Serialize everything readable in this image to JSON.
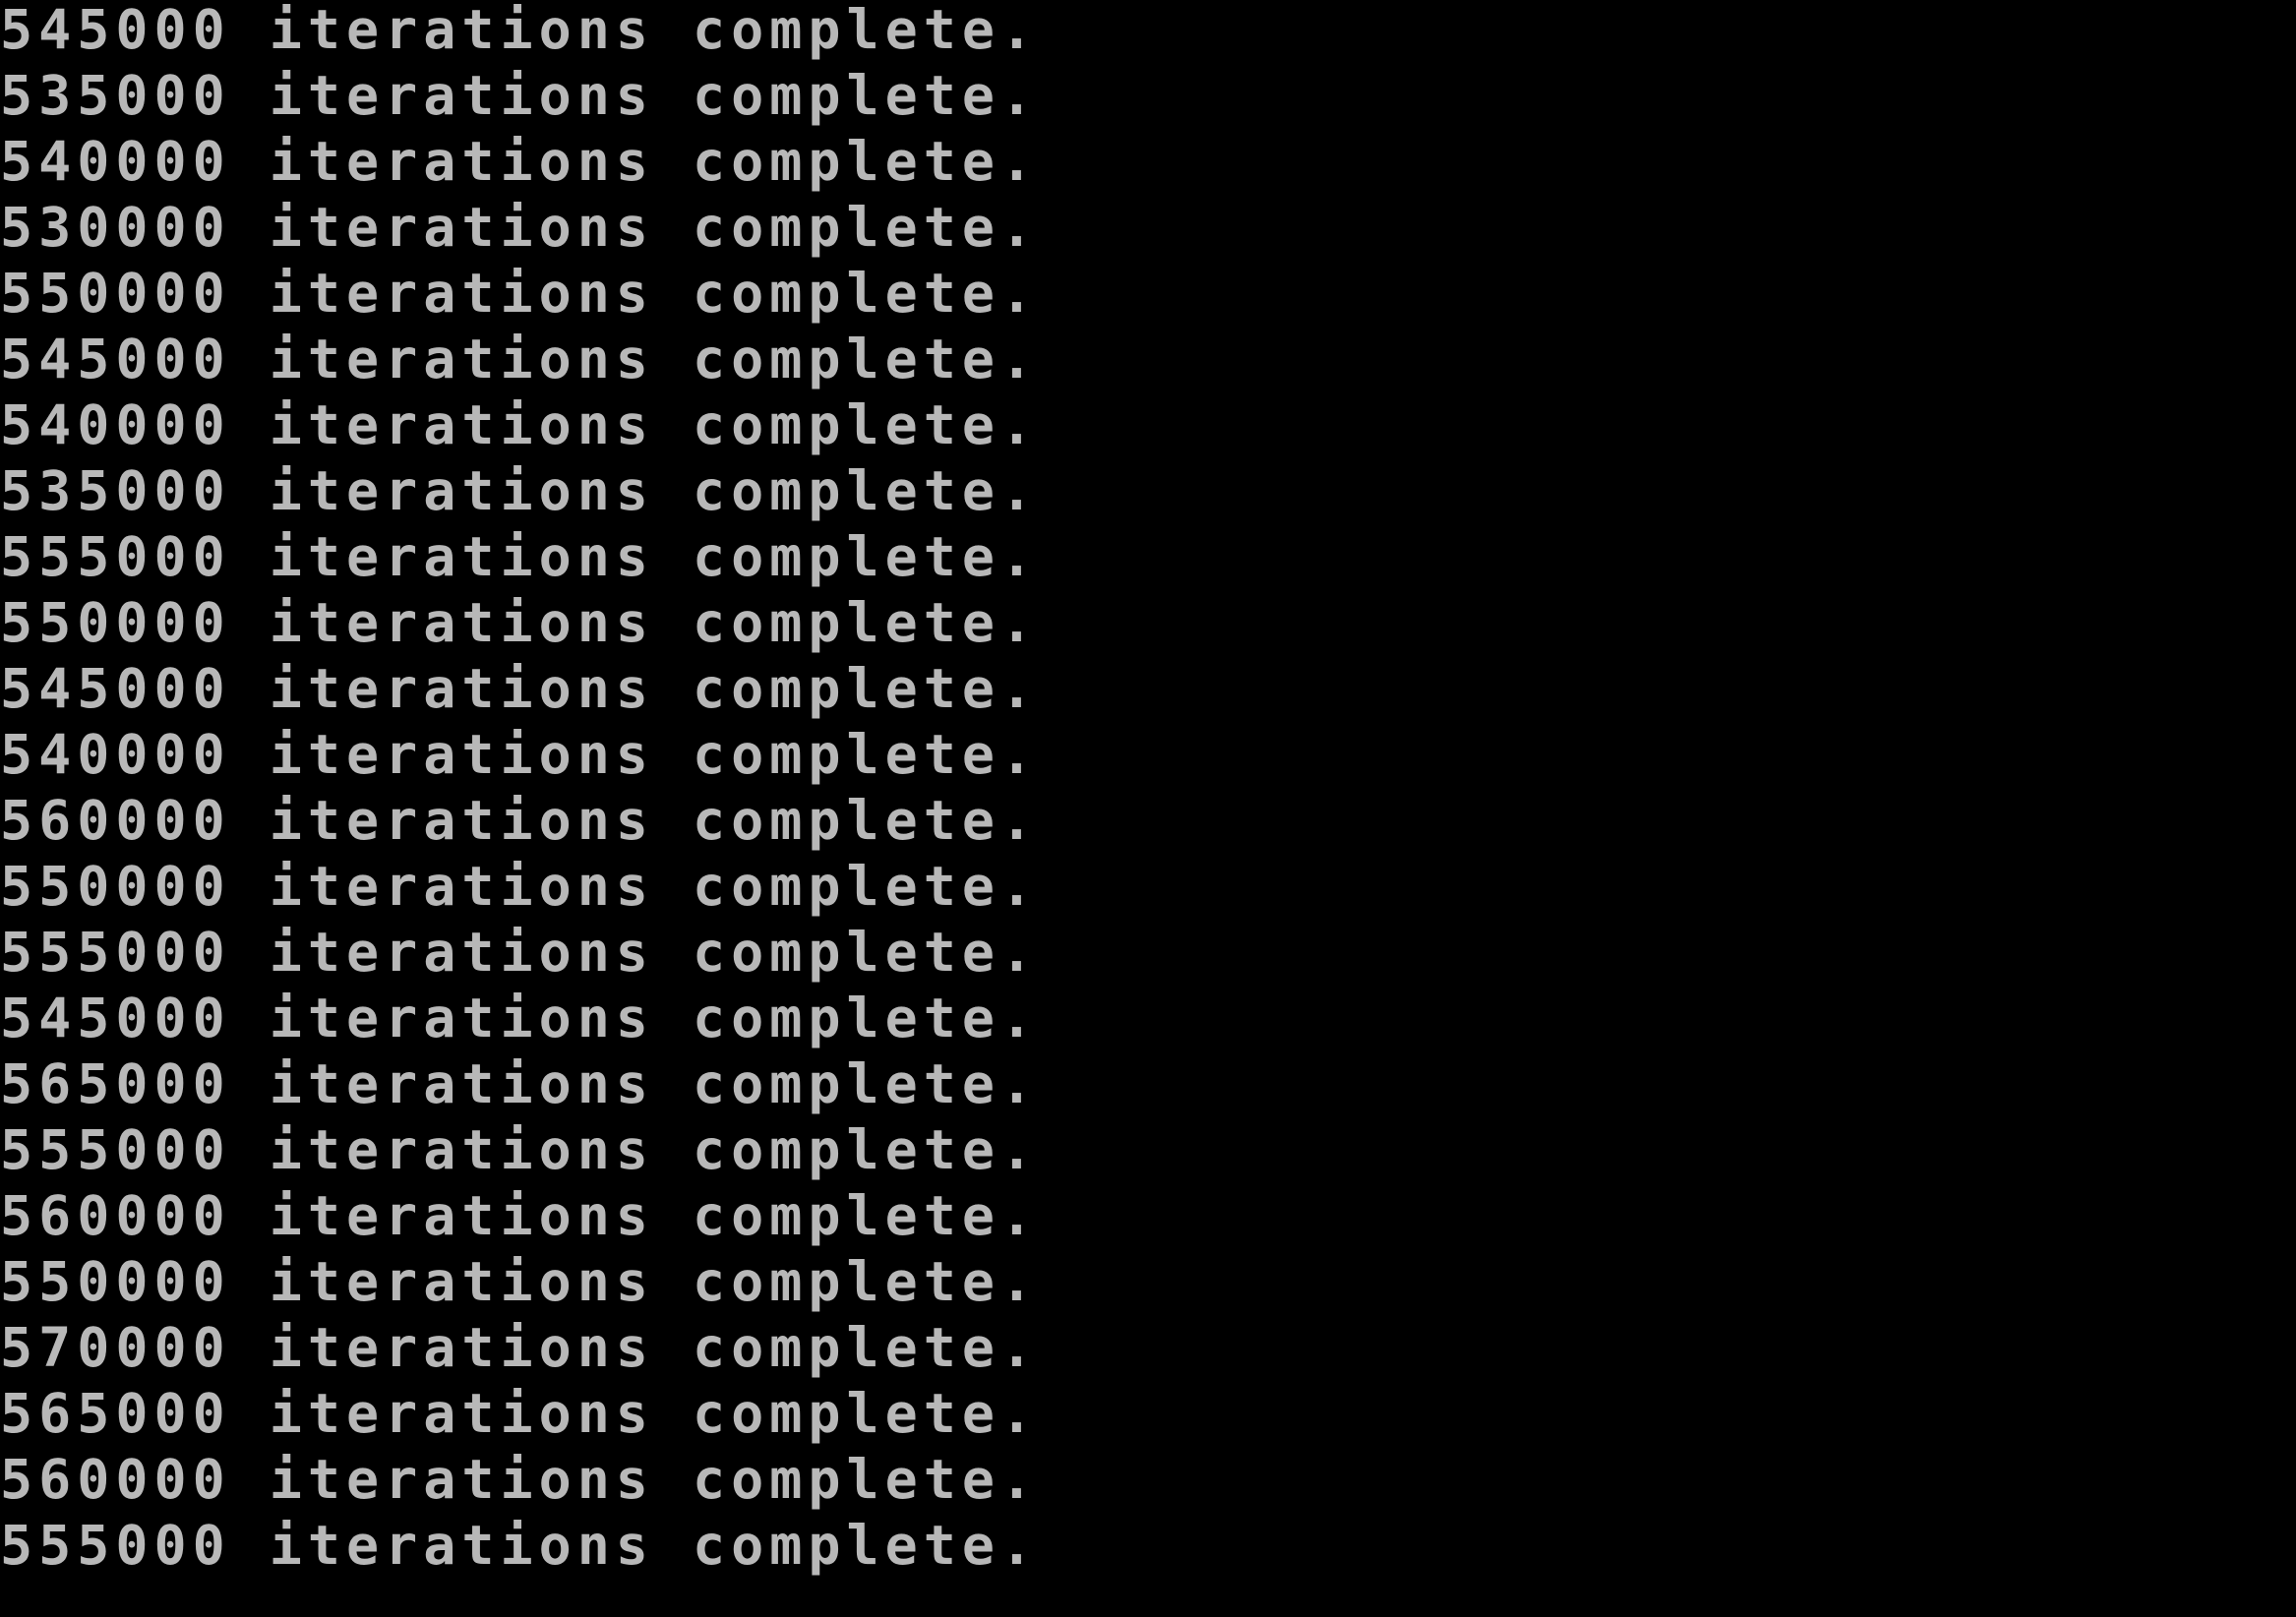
{
  "colors": {
    "background": "#000000",
    "text": "#b8b8b8"
  },
  "console": {
    "lines": [
      "545000 iterations complete.",
      "535000 iterations complete.",
      "540000 iterations complete.",
      "530000 iterations complete.",
      "550000 iterations complete.",
      "545000 iterations complete.",
      "540000 iterations complete.",
      "535000 iterations complete.",
      "555000 iterations complete.",
      "550000 iterations complete.",
      "545000 iterations complete.",
      "540000 iterations complete.",
      "560000 iterations complete.",
      "550000 iterations complete.",
      "555000 iterations complete.",
      "545000 iterations complete.",
      "565000 iterations complete.",
      "555000 iterations complete.",
      "560000 iterations complete.",
      "550000 iterations complete.",
      "570000 iterations complete.",
      "565000 iterations complete.",
      "560000 iterations complete.",
      "555000 iterations complete."
    ]
  }
}
